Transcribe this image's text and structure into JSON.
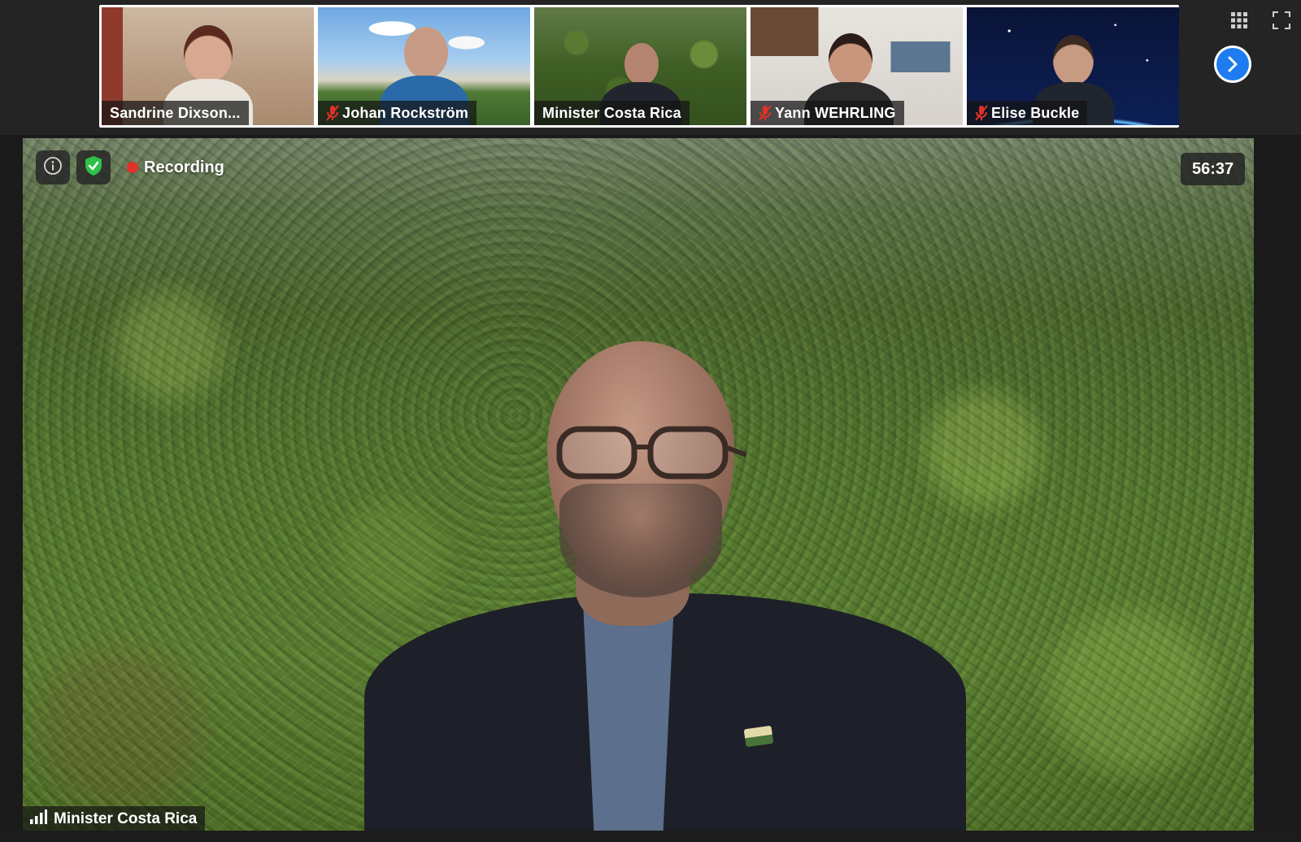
{
  "gallery": {
    "participants": [
      {
        "name": "Sandrine Dixson...",
        "muted": false,
        "active": false
      },
      {
        "name": "Johan Rockström",
        "muted": true,
        "active": false
      },
      {
        "name": "Minister Costa Rica",
        "muted": false,
        "active": true
      },
      {
        "name": "Yann WEHRLING",
        "muted": true,
        "active": false
      },
      {
        "name": "Elise Buckle",
        "muted": true,
        "active": false
      }
    ],
    "next_icon": "chevron-right-icon",
    "grid_icon": "grid-view-icon",
    "fullscreen_icon": "fullscreen-icon"
  },
  "stage": {
    "recording_label": "Recording",
    "timer": "56:37",
    "speaker_name": "Minister Costa Rica",
    "info_icon": "info-icon",
    "security_icon": "shield-check-icon",
    "signal_icon": "signal-bars-icon"
  },
  "colors": {
    "recording_dot": "#e0312a",
    "active_speaker_border": "#9ccc3a",
    "next_button": "#1f7cf0",
    "security_shield": "#2ec24a",
    "mute_icon": "#e0312a"
  }
}
